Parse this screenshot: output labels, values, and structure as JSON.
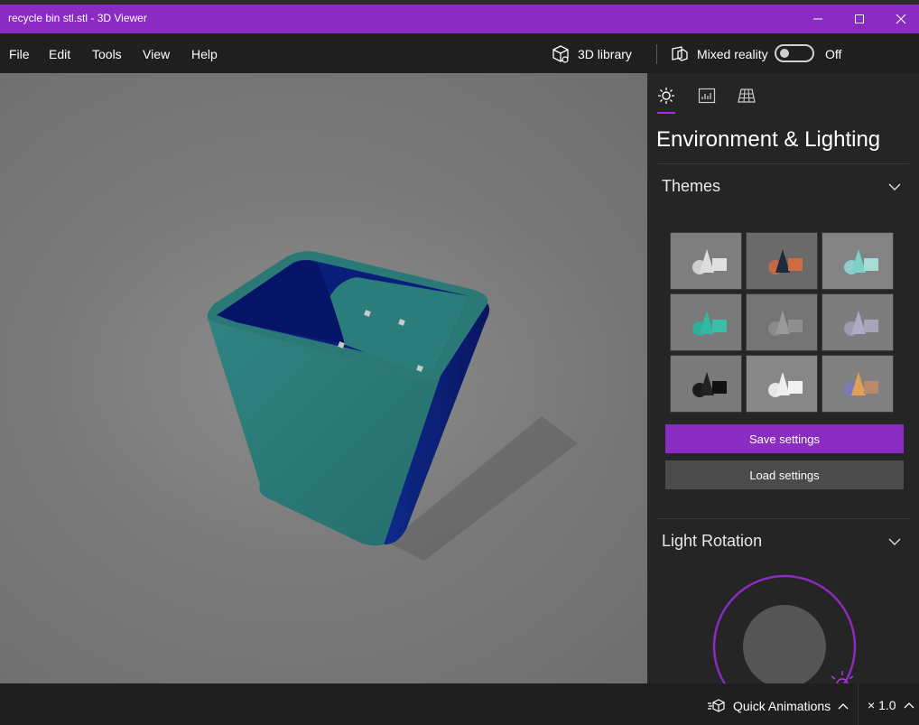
{
  "window": {
    "title": "recycle bin stl.stl - 3D Viewer"
  },
  "menu": {
    "items": [
      "File",
      "Edit",
      "Tools",
      "View",
      "Help"
    ]
  },
  "toolbar": {
    "library_label": "3D library",
    "mixed_reality_label": "Mixed reality",
    "mixed_reality_state": "Off"
  },
  "panel": {
    "title": "Environment & Lighting",
    "tabs": [
      "lighting-tab",
      "stats-tab",
      "grid-tab"
    ],
    "themes_label": "Themes",
    "save_label": "Save settings",
    "load_label": "Load settings",
    "light_rotation_label": "Light Rotation"
  },
  "status": {
    "quick_animations_label": "Quick Animations",
    "speed_label": "× 1.0"
  },
  "colors": {
    "accent": "#8a2bc2",
    "model_teal": "#2b7a78",
    "model_navy": "#0b1a6e"
  }
}
